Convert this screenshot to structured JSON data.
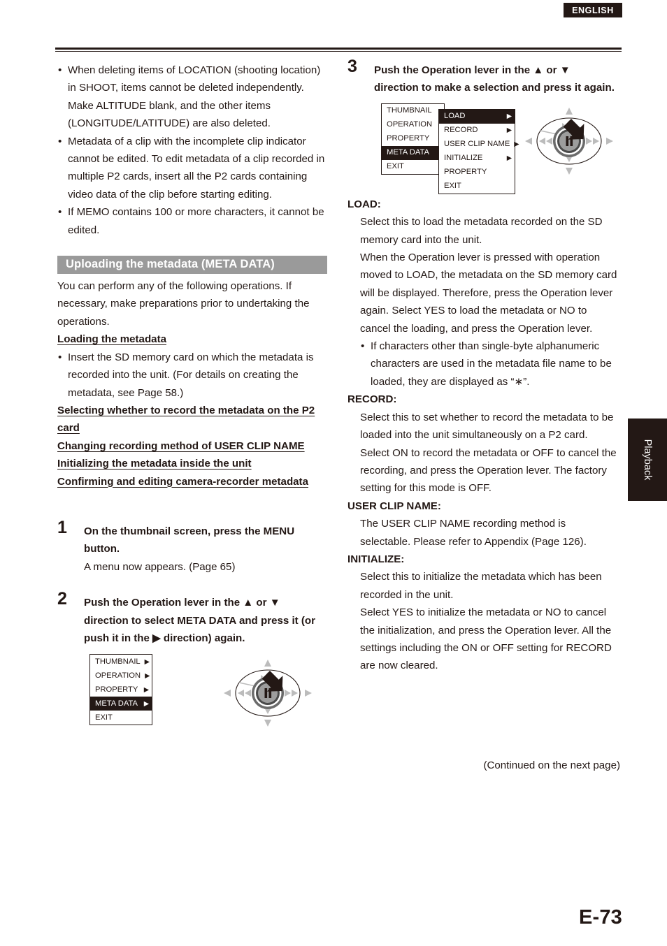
{
  "header": {
    "language_badge": "ENGLISH"
  },
  "left_column": {
    "notes": [
      "When deleting items of LOCATION (shooting location) in SHOOT, items cannot be deleted independently. Make ALTITUDE blank, and the other items (LONGITUDE/LATITUDE) are also deleted.",
      "Metadata of a clip with the incomplete clip indicator cannot be edited. To edit metadata of a clip recorded in multiple P2 cards, insert all the P2 cards containing video data of the clip before starting editing.",
      "If MEMO contains 100 or more characters, it cannot be edited."
    ],
    "section_heading": "Uploading the metadata (META DATA)",
    "intro": "You can perform any of the following operations. If necessary, make preparations prior to undertaking the operations.",
    "subheads": [
      "Loading the metadata",
      "Selecting whether to record the metadata on the P2 card",
      "Changing recording method of USER CLIP NAME",
      "Initializing the metadata inside the unit",
      "Confirming and editing camera-recorder metadata"
    ],
    "loading_bullet": "Insert the SD memory card on which the metadata is recorded into the unit. (For details on creating the metadata, see Page 58.)",
    "step1": {
      "number": "1",
      "title": "On the thumbnail screen, press the MENU button.",
      "body": "A menu now appears. (Page 65)"
    },
    "step2": {
      "number": "2",
      "title": "Push the Operation lever in the ▲ or ▼ direction to select META DATA and press it (or push it in the ▶ direction) again."
    },
    "menu1": {
      "items": [
        {
          "label": "THUMBNAIL",
          "arrow": "▶",
          "selected": false
        },
        {
          "label": "OPERATION",
          "arrow": "▶",
          "selected": false
        },
        {
          "label": "PROPERTY",
          "arrow": "▶",
          "selected": false
        },
        {
          "label": "META DATA",
          "arrow": "▶",
          "selected": true
        },
        {
          "label": "EXIT",
          "arrow": "",
          "selected": false
        }
      ]
    }
  },
  "right_column": {
    "step3": {
      "number": "3",
      "title": "Push the Operation lever in the ▲ or ▼ direction to make a selection and press it again."
    },
    "menu2": {
      "parent_items": [
        {
          "label": "THUMBNAIL",
          "selected": false
        },
        {
          "label": "OPERATION",
          "selected": false
        },
        {
          "label": "PROPERTY",
          "selected": false
        },
        {
          "label": "META DATA",
          "selected": true
        },
        {
          "label": "EXIT",
          "selected": false
        }
      ],
      "sub_items": [
        {
          "label": "LOAD",
          "arrow": "▶",
          "selected": true
        },
        {
          "label": "RECORD",
          "arrow": "▶",
          "selected": false
        },
        {
          "label": "USER CLIP NAME",
          "arrow": "▶",
          "selected": false
        },
        {
          "label": "INITIALIZE",
          "arrow": "▶",
          "selected": false
        },
        {
          "label": "PROPERTY",
          "arrow": "",
          "selected": false
        },
        {
          "label": "EXIT",
          "arrow": "",
          "selected": false
        }
      ]
    },
    "definitions": [
      {
        "term": "LOAD:",
        "paragraphs": [
          "Select this to load the metadata recorded on the SD memory card into the unit.",
          "When the Operation lever is pressed with operation moved to LOAD, the metadata on the SD memory card will be displayed. Therefore, press the Operation lever again. Select YES to load the metadata or NO to cancel the loading, and press the Operation lever."
        ],
        "bullets": [
          "If characters other than single-byte alphanumeric characters are used in the metadata file name to be loaded, they are displayed as “∗”."
        ]
      },
      {
        "term": "RECORD:",
        "paragraphs": [
          "Select this to set whether to record the metadata to be loaded into the unit simultaneously on a P2 card.",
          "Select ON to record the metadata or OFF to cancel the recording, and press the Operation lever. The factory setting for this mode is OFF."
        ],
        "bullets": []
      },
      {
        "term": "USER CLIP NAME:",
        "paragraphs": [
          "The USER CLIP NAME recording method is selectable. Please refer to Appendix (Page 126)."
        ],
        "bullets": []
      },
      {
        "term": "INITIALIZE:",
        "paragraphs": [
          "Select this to initialize the metadata which has been recorded in the unit.",
          "Select YES to initialize the metadata or NO to cancel the initialization, and press the Operation lever. All the settings including the ON or OFF setting for RECORD are now cleared."
        ],
        "bullets": []
      }
    ],
    "continued": "(Continued on the next page)"
  },
  "side_tab": {
    "label": "Playback"
  },
  "footer": {
    "page_number": "E-73"
  }
}
